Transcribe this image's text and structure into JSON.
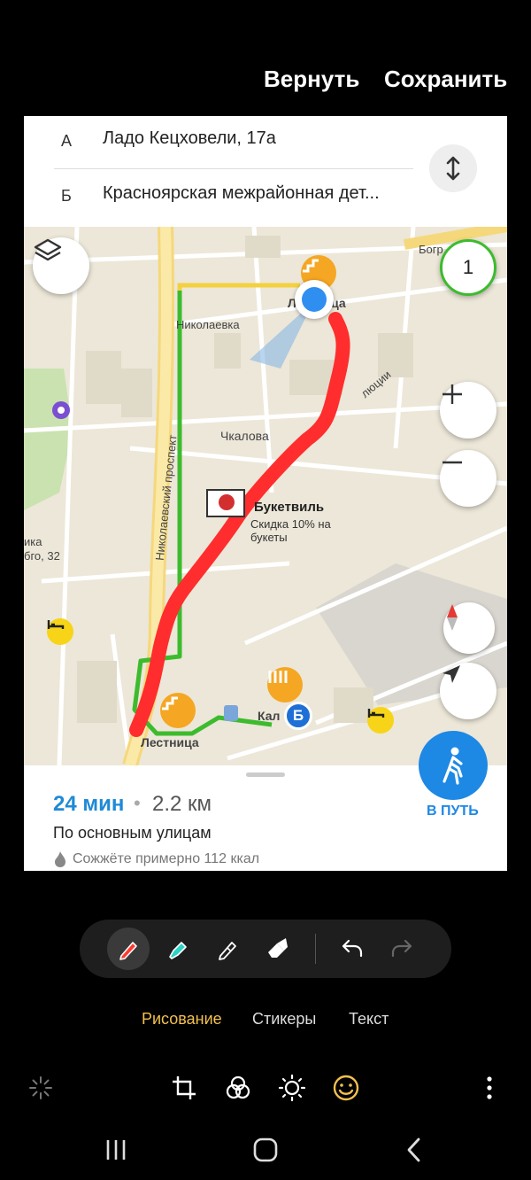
{
  "top_actions": {
    "undo": "Вернуть",
    "save": "Сохранить"
  },
  "route_panel": {
    "from_letter": "А",
    "from_address": "Ладо Кецховели, 17а",
    "to_letter": "Б",
    "to_address": "Красноярская межрайонная дет..."
  },
  "map": {
    "streets": {
      "nikolaevka": "Николаевка",
      "prospect": "Николаевский проспект",
      "chkalova": "Чкалова",
      "lestnitsa_top": "Лестница",
      "lestnitsa_bottom": "Лестница",
      "kal": "Кал",
      "bogr": "Богр",
      "revolyutsii": "люции",
      "ika": "ика",
      "bgo32": "бго, 32"
    },
    "poi": {
      "name": "Букетвиль",
      "promo": "Скидка 10% на букеты"
    },
    "badge_count": "1",
    "marker_b": "Б",
    "colors": {
      "route_green": "#3dbb2e",
      "route_yellow": "#f4d03f",
      "drawing_red": "#ff2d2d",
      "accent_blue": "#1e88e5"
    }
  },
  "route_info": {
    "duration": "24 мин",
    "separator": "•",
    "distance": "2.2 км",
    "description": "По основным улицам",
    "calories": "Сожжёте примерно 112 ккал",
    "go_label": "В ПУТЬ"
  },
  "modes": {
    "drawing": "Рисование",
    "stickers": "Стикеры",
    "text": "Текст"
  }
}
